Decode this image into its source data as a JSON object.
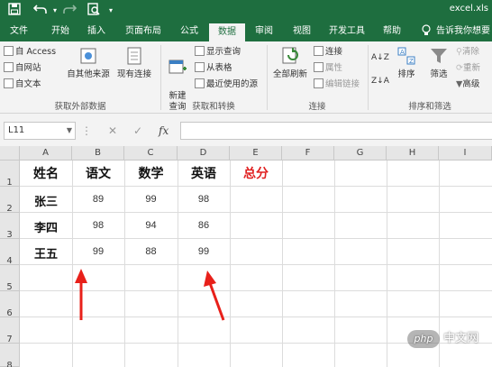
{
  "window": {
    "title": "excel.xls"
  },
  "quick_access": {
    "redo_icon": "redo-icon",
    "undo_icon": "undo-icon",
    "save_icon": "save-icon",
    "preview_icon": "print-preview-icon",
    "customize_icon": "customize-icon"
  },
  "tabs": [
    {
      "label": "文件"
    },
    {
      "label": "开始"
    },
    {
      "label": "插入"
    },
    {
      "label": "页面布局"
    },
    {
      "label": "公式"
    },
    {
      "label": "数据"
    },
    {
      "label": "审阅"
    },
    {
      "label": "视图"
    },
    {
      "label": "开发工具"
    },
    {
      "label": "帮助"
    },
    {
      "label": "告诉我你想要"
    }
  ],
  "ribbon": {
    "get_external": {
      "access": "自 Access",
      "web": "自网站",
      "text": "自文本",
      "other_sources": "自其他来源",
      "existing": "现有连接",
      "group_label": "获取外部数据"
    },
    "get_transform": {
      "new_query": "新建\n查询",
      "show_queries": "显示查询",
      "from_table": "从表格",
      "recent_sources": "最近使用的源",
      "group_label": "获取和转换"
    },
    "connections": {
      "refresh_all": "全部刷新",
      "connections": "连接",
      "properties": "属性",
      "edit_links": "编辑链接",
      "group_label": "连接"
    },
    "sort_filter": {
      "sort": "排序",
      "filter": "筛选",
      "clear": "清除",
      "reapply": "重新",
      "advanced": "高级",
      "group_label": "排序和筛选"
    }
  },
  "formula_bar": {
    "name_box": "L11",
    "cancel": "✕",
    "enter": "✓",
    "fx": "fx",
    "formula": ""
  },
  "sheet": {
    "columns": [
      "A",
      "B",
      "C",
      "D",
      "E",
      "F",
      "G",
      "H",
      "I"
    ],
    "rows": [
      "1",
      "2",
      "3",
      "4",
      "5",
      "6",
      "7",
      "8"
    ],
    "header": [
      "姓名",
      "语文",
      "数学",
      "英语",
      "总分"
    ],
    "data": [
      {
        "name": "张三",
        "chinese": "89",
        "math": "99",
        "english": "98"
      },
      {
        "name": "李四",
        "chinese": "98",
        "math": "94",
        "english": "86"
      },
      {
        "name": "王五",
        "chinese": "99",
        "math": "88",
        "english": "99"
      }
    ]
  },
  "watermark": {
    "logo": "php",
    "text": "中文网"
  },
  "colors": {
    "brand_green": "#1e6e3f",
    "total_red": "#e02020",
    "arrow_red": "#e8201a"
  }
}
